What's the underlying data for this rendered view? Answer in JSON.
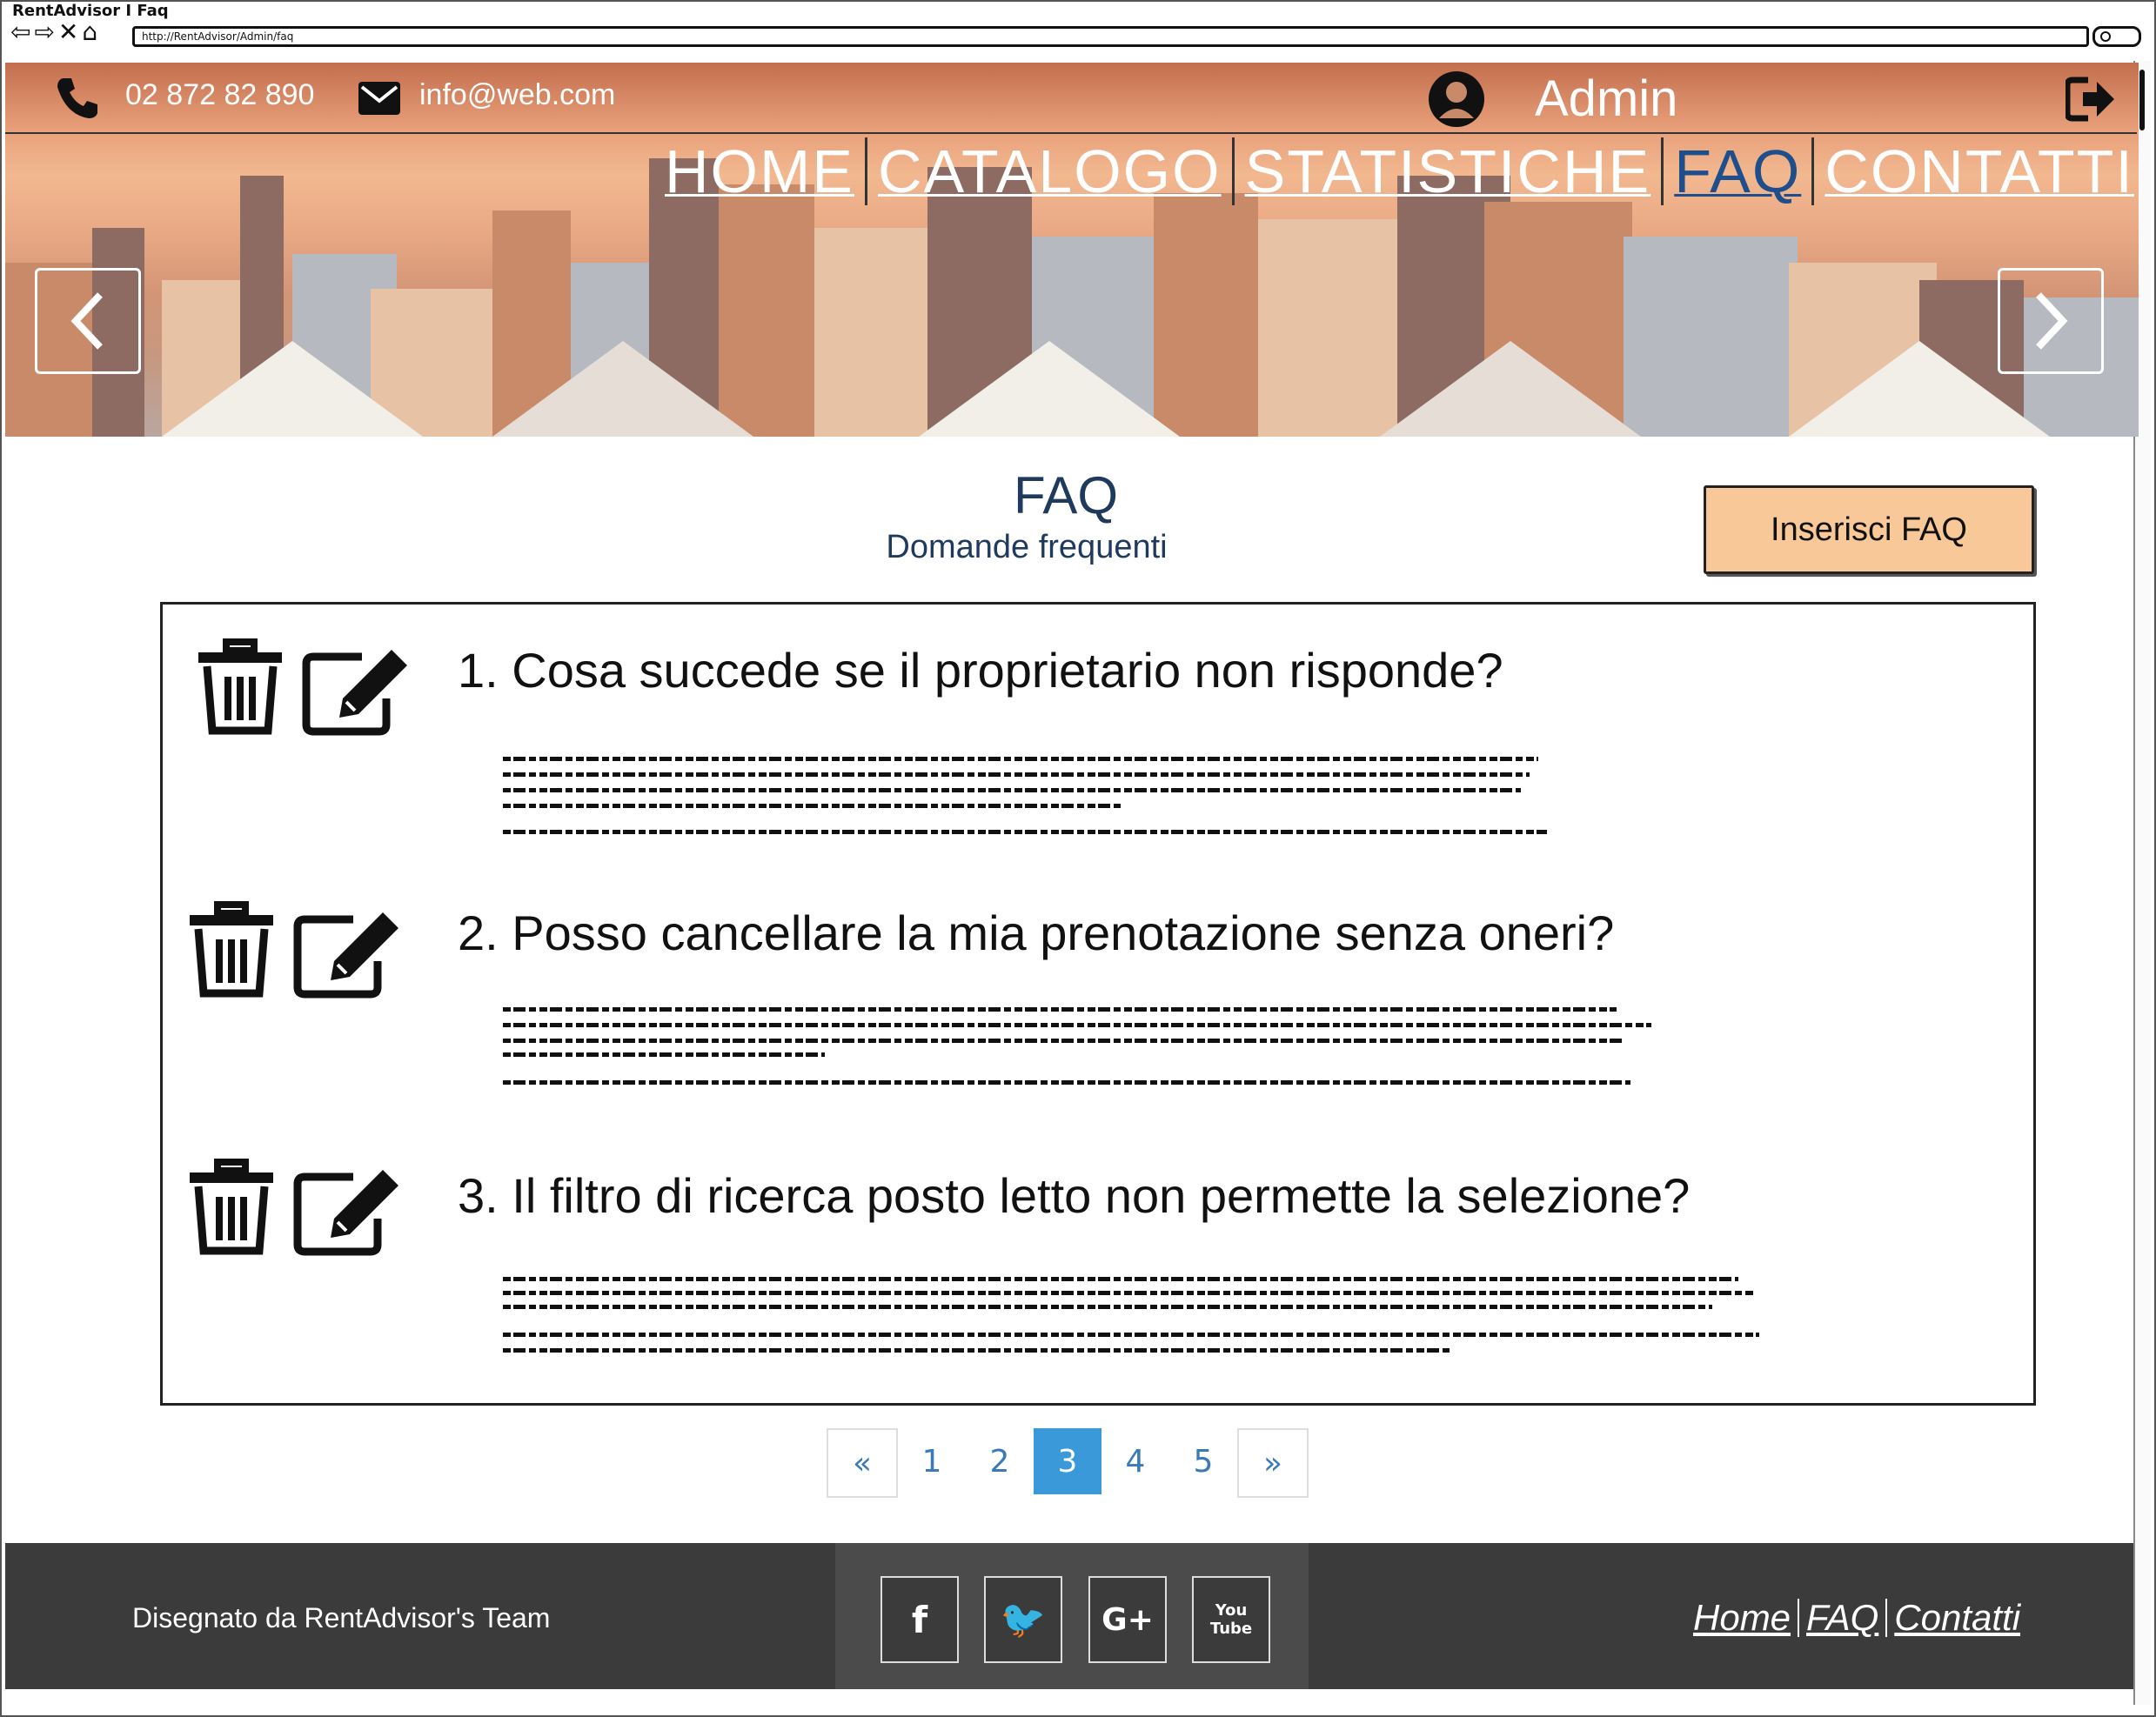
{
  "window": {
    "title": "RentAdvisor I Faq",
    "url": "http://RentAdvisor/Admin/faq"
  },
  "topbar": {
    "phone": "02 872 82 890",
    "email": "info@web.com",
    "user": "Admin"
  },
  "nav": {
    "items": [
      "HOME",
      "CATALOGO",
      "STATISTICHE",
      "FAQ",
      "CONTATTI"
    ],
    "active": "FAQ"
  },
  "faq": {
    "title": "FAQ",
    "subtitle": "Domande frequenti",
    "insert_button": "Inserisci FAQ",
    "items": [
      {
        "question": "1. Cosa succede se il proprietario non risponde?"
      },
      {
        "question": "2. Posso cancellare la mia prenotazione senza oneri?"
      },
      {
        "question": "3. Il filtro di ricerca posto letto non permette la selezione?"
      }
    ]
  },
  "pagination": {
    "prev": "«",
    "pages": [
      "1",
      "2",
      "3",
      "4",
      "5"
    ],
    "current": "3",
    "next": "»"
  },
  "footer": {
    "credit": "Disegnato da RentAdvisor's Team",
    "social": [
      "facebook-icon",
      "twitter-icon",
      "google-plus-icon",
      "youtube-icon"
    ],
    "social_glyphs": [
      "f",
      "🐦",
      "G+",
      "You Tube"
    ],
    "links": [
      "Home",
      "FAQ",
      "Contatti"
    ]
  },
  "colors": {
    "nav_active": "#1f4e8c",
    "button_bg": "#f8c898",
    "page_active": "#3a9ad9",
    "footer_bg": "#3b3b3b",
    "title": "#1f3a5c"
  }
}
